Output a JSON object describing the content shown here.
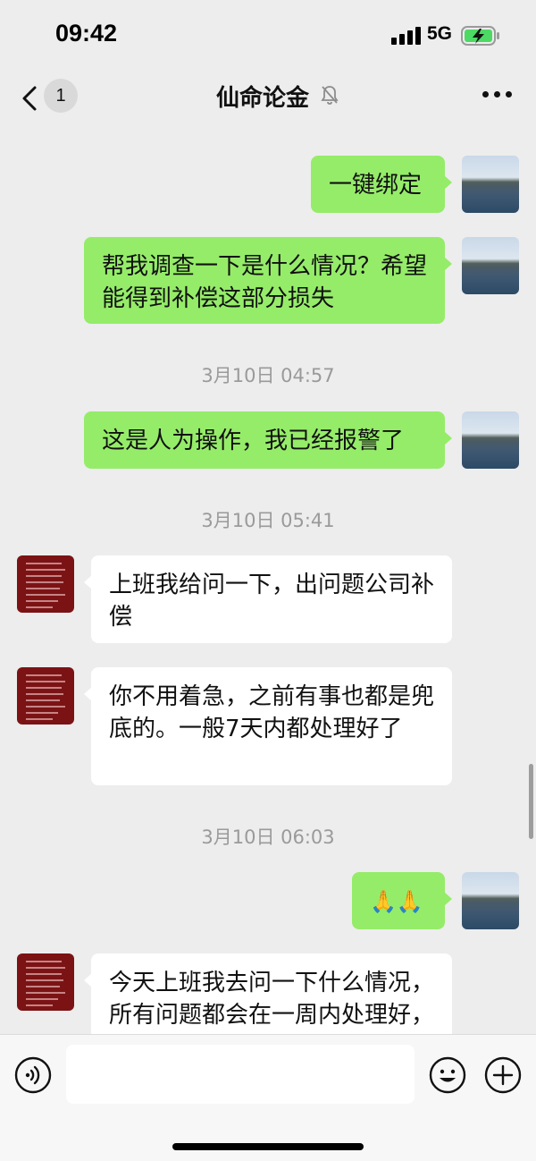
{
  "status_bar": {
    "time": "09:42",
    "network": "5G",
    "battery_icon": "battery-charging-icon"
  },
  "nav": {
    "unread_count": "1",
    "title": "仙命论金",
    "mute_icon": "bell-muted-icon",
    "back_icon": "chevron-left-icon",
    "more_icon": "more-dots-icon"
  },
  "messages": {
    "m1": {
      "sender": "self",
      "text": "一键绑定"
    },
    "m2": {
      "sender": "self",
      "text": "帮我调查一下是什么情况？希望能得到补偿这部分损失"
    },
    "t1": "3月10日 04:57",
    "m3": {
      "sender": "self",
      "text": "这是人为操作，我已经报警了"
    },
    "t2": "3月10日 05:41",
    "m4": {
      "sender": "other",
      "text": "上班我给问一下，出问题公司补偿"
    },
    "m5": {
      "sender": "other",
      "text": "你不用着急，之前有事也都是兜底的。一般7天内都处理好了"
    },
    "t3": "3月10日 06:03",
    "m6": {
      "sender": "self",
      "text": "🙏🙏"
    },
    "m7": {
      "sender": "other",
      "text": "今天上班我去问一下什么情况，所有问题都会在一周内处理好，请不要着急"
    }
  },
  "input_bar": {
    "voice_icon": "voice-icon",
    "emoji_icon": "emoji-icon",
    "plus_icon": "plus-icon",
    "placeholder": ""
  },
  "colors": {
    "background": "#ededed",
    "self_bubble": "#95ec69",
    "other_bubble": "#ffffff",
    "timestamp": "#9a9a9a"
  }
}
